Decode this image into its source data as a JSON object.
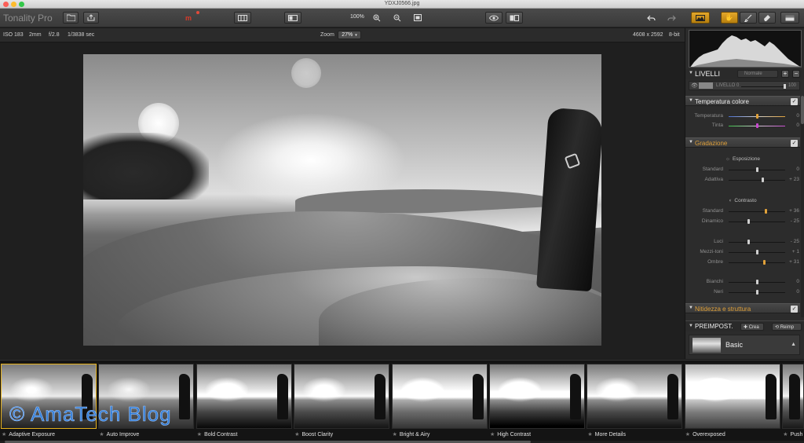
{
  "window": {
    "title": "YDXJ0566.jpg"
  },
  "toolbar": {
    "app_name": "Tonality Pro",
    "zoom_value": "100%",
    "m_logo": "m"
  },
  "info_bar": {
    "iso": "ISO 183",
    "focal": "2mm",
    "aperture": "f/2.8",
    "shutter": "1/3838 sec",
    "zoom_label": "Zoom",
    "zoom_value": "27%",
    "dimensions": "4608 x 2592",
    "bit_depth": "8-bit"
  },
  "panel": {
    "layers": {
      "title": "LIVELLI",
      "blend_mode": "Normale",
      "add": "+",
      "remove": "−",
      "layer_name": "LIVELLO 0",
      "opacity": "100"
    },
    "temperature": {
      "title": "Temperatura colore",
      "sliders": [
        {
          "label": "Temperatura",
          "value": "0",
          "pos": 0.5,
          "color": "#e0a13a"
        },
        {
          "label": "Tinta",
          "value": "0",
          "pos": 0.5,
          "color": "#c84ad0"
        }
      ]
    },
    "gradation": {
      "title": "Gradazione",
      "exposure_title": "Esposizione",
      "exposure": [
        {
          "label": "Standard",
          "value": "0",
          "pos": 0.5
        },
        {
          "label": "Adattiva",
          "value": "+ 23",
          "pos": 0.6
        }
      ],
      "contrast_title": "Contrasto",
      "contrast": [
        {
          "label": "Standard",
          "value": "+ 36",
          "pos": 0.65,
          "color": "#e0a13a"
        },
        {
          "label": "Dinamico",
          "value": "- 25",
          "pos": 0.35
        }
      ],
      "tones": [
        {
          "label": "Luci",
          "value": "- 25",
          "pos": 0.35
        },
        {
          "label": "Mezzi-toni",
          "value": "+ 1",
          "pos": 0.5
        },
        {
          "label": "Ombre",
          "value": "+ 31",
          "pos": 0.62,
          "color": "#e0a13a"
        }
      ],
      "points": [
        {
          "label": "Bianchi",
          "value": "0",
          "pos": 0.5
        },
        {
          "label": "Neri",
          "value": "0",
          "pos": 0.5
        }
      ]
    },
    "sharpness": {
      "title": "Nitidezza e struttura"
    },
    "presets": {
      "title": "PREIMPOST.",
      "create": "Crea",
      "reset": "Reimp",
      "current": "Basic"
    }
  },
  "filmstrip": {
    "watermark": "© AmaTech Blog",
    "items": [
      "Adaptive Exposure",
      "Auto Improve",
      "Bold Contrast",
      "Boost Clarity",
      "Bright & Airy",
      "High Contrast",
      "More Details",
      "Overexposed",
      "Push High"
    ]
  },
  "colors": {
    "accent": "#e6b21d",
    "orange_label": "#e0a13a",
    "watermark": "#2e7bd6"
  }
}
